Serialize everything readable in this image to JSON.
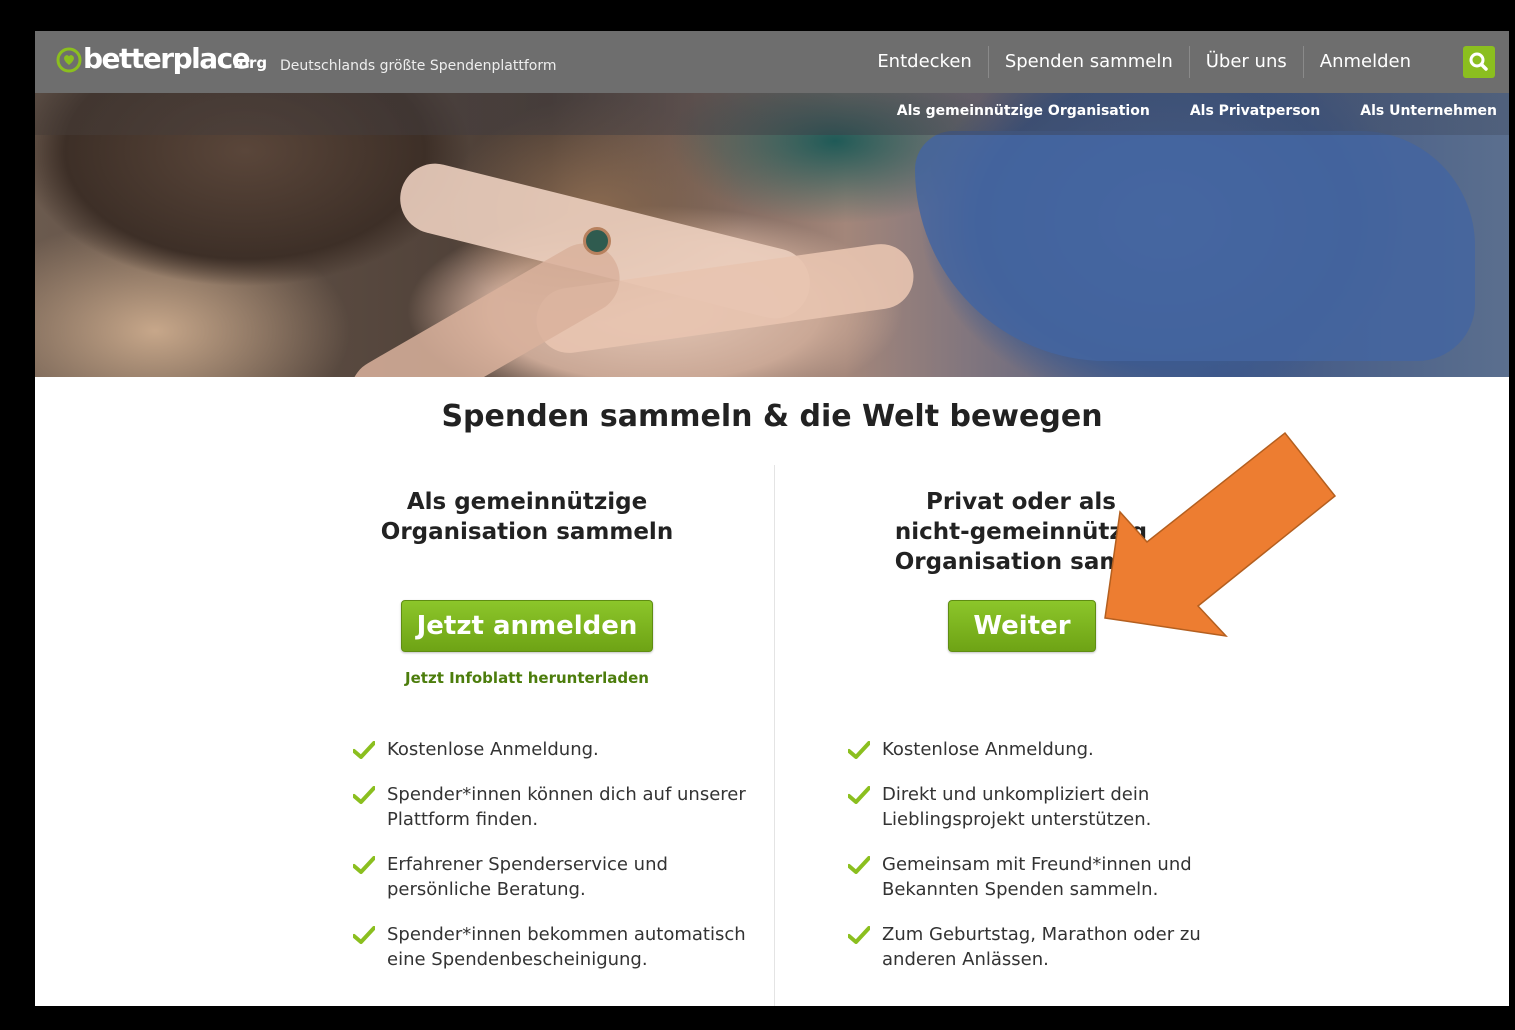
{
  "header": {
    "logo_text": "betterplace",
    "logo_suffix": ".org",
    "tagline": "Deutschlands größte Spendenplattform",
    "nav": [
      "Entdecken",
      "Spenden sammeln",
      "Über uns",
      "Anmelden"
    ],
    "subnav": [
      "Als gemeinnützige Organisation",
      "Als Privatperson",
      "Als Unternehmen"
    ]
  },
  "main": {
    "heading": "Spenden sammeln & die Welt bewegen",
    "left": {
      "title_line1": "Als gemeinnützige",
      "title_line2": "Organisation sammeln",
      "button": "Jetzt anmelden",
      "link": "Jetzt Infoblatt herunterladen",
      "features": [
        [
          "Kostenlose Anmeldung."
        ],
        [
          "Spender*innen können dich auf unserer",
          "Plattform finden."
        ],
        [
          "Erfahrener Spenderservice und",
          "persönliche Beratung."
        ],
        [
          "Spender*innen bekommen automatisch",
          "eine Spendenbescheinigung."
        ]
      ]
    },
    "right": {
      "title_line1": "Privat oder als",
      "title_line2": "nicht-gemeinnützig",
      "title_line3": "Organisation samm",
      "button": "Weiter",
      "features": [
        [
          "Kostenlose Anmeldung."
        ],
        [
          "Direkt und unkompliziert dein",
          "Lieblingsprojekt unterstützen."
        ],
        [
          "Gemeinsam mit Freund*innen und",
          "Bekannten Spenden sammeln."
        ],
        [
          "Zum Geburtstag, Marathon oder zu",
          "anderen Anlässen."
        ]
      ]
    }
  },
  "colors": {
    "brand_green": "#8bbf1f",
    "button_green": "#76ad1a",
    "link_green": "#4c7d0c",
    "header_gray": "#6e6e6e",
    "annotation_orange": "#ed7d31"
  },
  "icons": {
    "logo": "heart-pin-icon",
    "search": "search-icon",
    "check": "check-icon",
    "annotation": "arrow-icon"
  }
}
